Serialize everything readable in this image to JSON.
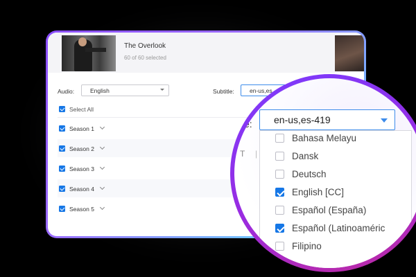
{
  "header": {
    "title": "The Overlook",
    "selected": "60 of 60 selected"
  },
  "audio": {
    "label": "Audio:",
    "value": "English"
  },
  "subtitle": {
    "label": "Subtitle:",
    "value": "en-us,es"
  },
  "select_all": {
    "label": "Select All"
  },
  "seasons": [
    {
      "label": "Season 1"
    },
    {
      "label": "Season 2"
    },
    {
      "label": "Season 3"
    },
    {
      "label": "Season 4"
    },
    {
      "label": "Season 5"
    }
  ],
  "magnifier": {
    "label_fragment": "e:",
    "value": "en-us,es-419",
    "ghost_text": "T",
    "options": [
      {
        "label": "Bahasa Melayu",
        "checked": false
      },
      {
        "label": "Dansk",
        "checked": false
      },
      {
        "label": "Deutsch",
        "checked": false
      },
      {
        "label": "English [CC]",
        "checked": true
      },
      {
        "label": "Español (España)",
        "checked": false
      },
      {
        "label": "Español (Latinoaméric",
        "checked": true
      },
      {
        "label": "Filipino",
        "checked": false
      }
    ]
  },
  "colors": {
    "accent": "#1677e6",
    "frame_start": "#8a4dff",
    "frame_end": "#5fe0e8",
    "lens_ring": "#9a2be0"
  }
}
